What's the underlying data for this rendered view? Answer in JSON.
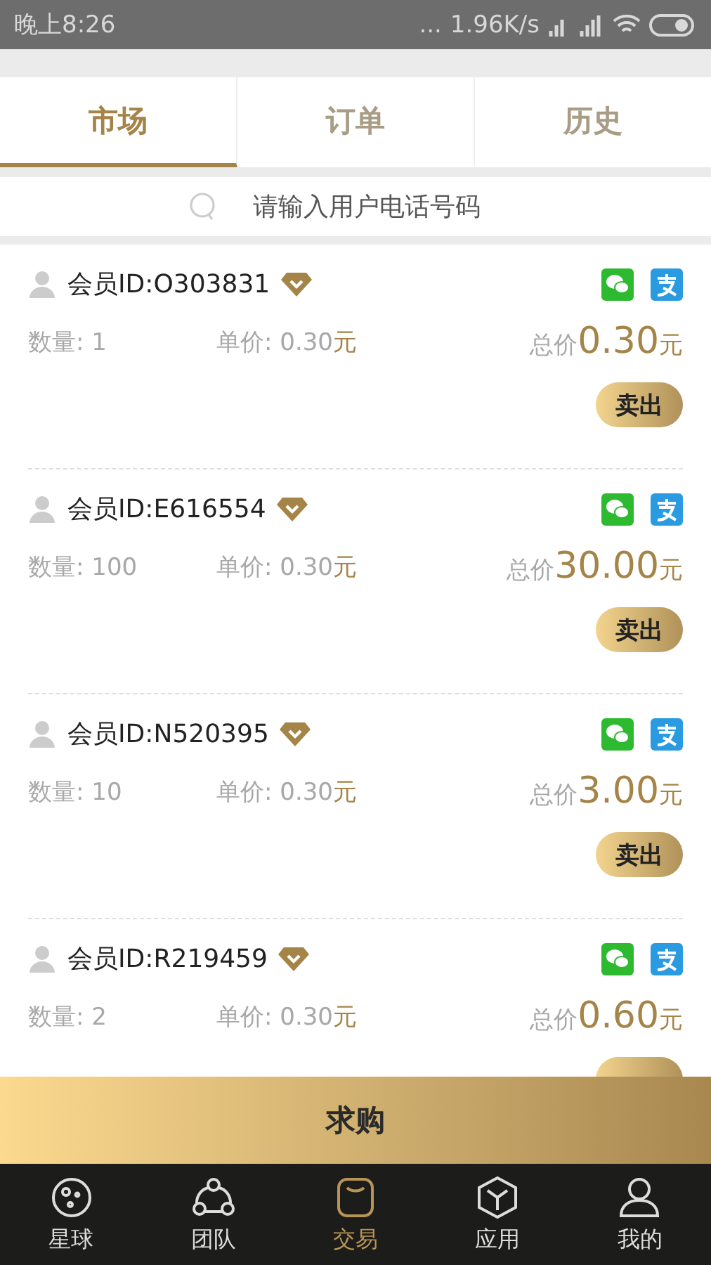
{
  "status_bar": {
    "time": "晚上8:26",
    "network_speed": "1.96K/s",
    "dots": "..."
  },
  "tabs": [
    {
      "label": "市场",
      "selected": true
    },
    {
      "label": "订单",
      "selected": false
    },
    {
      "label": "历史",
      "selected": false
    }
  ],
  "search": {
    "placeholder": "请输入用户电话号码"
  },
  "orders": [
    {
      "member": "会员ID:O303831",
      "quantity": "数量: 1",
      "unit_price_label": "单价: 0.30",
      "unit_price_currency": "元",
      "total_label": "总价",
      "total": "0.30",
      "total_currency": "元",
      "sell": "卖出"
    },
    {
      "member": "会员ID:E616554",
      "quantity": "数量: 100",
      "unit_price_label": "单价: 0.30",
      "unit_price_currency": "元",
      "total_label": "总价",
      "total": "30.00",
      "total_currency": "元",
      "sell": "卖出"
    },
    {
      "member": "会员ID:N520395",
      "quantity": "数量: 10",
      "unit_price_label": "单价: 0.30",
      "unit_price_currency": "元",
      "total_label": "总价",
      "total": "3.00",
      "total_currency": "元",
      "sell": "卖出"
    },
    {
      "member": "会员ID:R219459",
      "quantity": "数量: 2",
      "unit_price_label": "单价: 0.30",
      "unit_price_currency": "元",
      "total_label": "总价",
      "total": "0.60",
      "total_currency": "元"
    }
  ],
  "buy_button": "求购",
  "nav": [
    {
      "label": "星球",
      "kind": "planet",
      "selected": false
    },
    {
      "label": "团队",
      "kind": "team",
      "selected": false
    },
    {
      "label": "交易",
      "kind": "bag",
      "selected": true
    },
    {
      "label": "应用",
      "kind": "cube",
      "selected": false
    },
    {
      "label": "我的",
      "kind": "user",
      "selected": false
    }
  ]
}
